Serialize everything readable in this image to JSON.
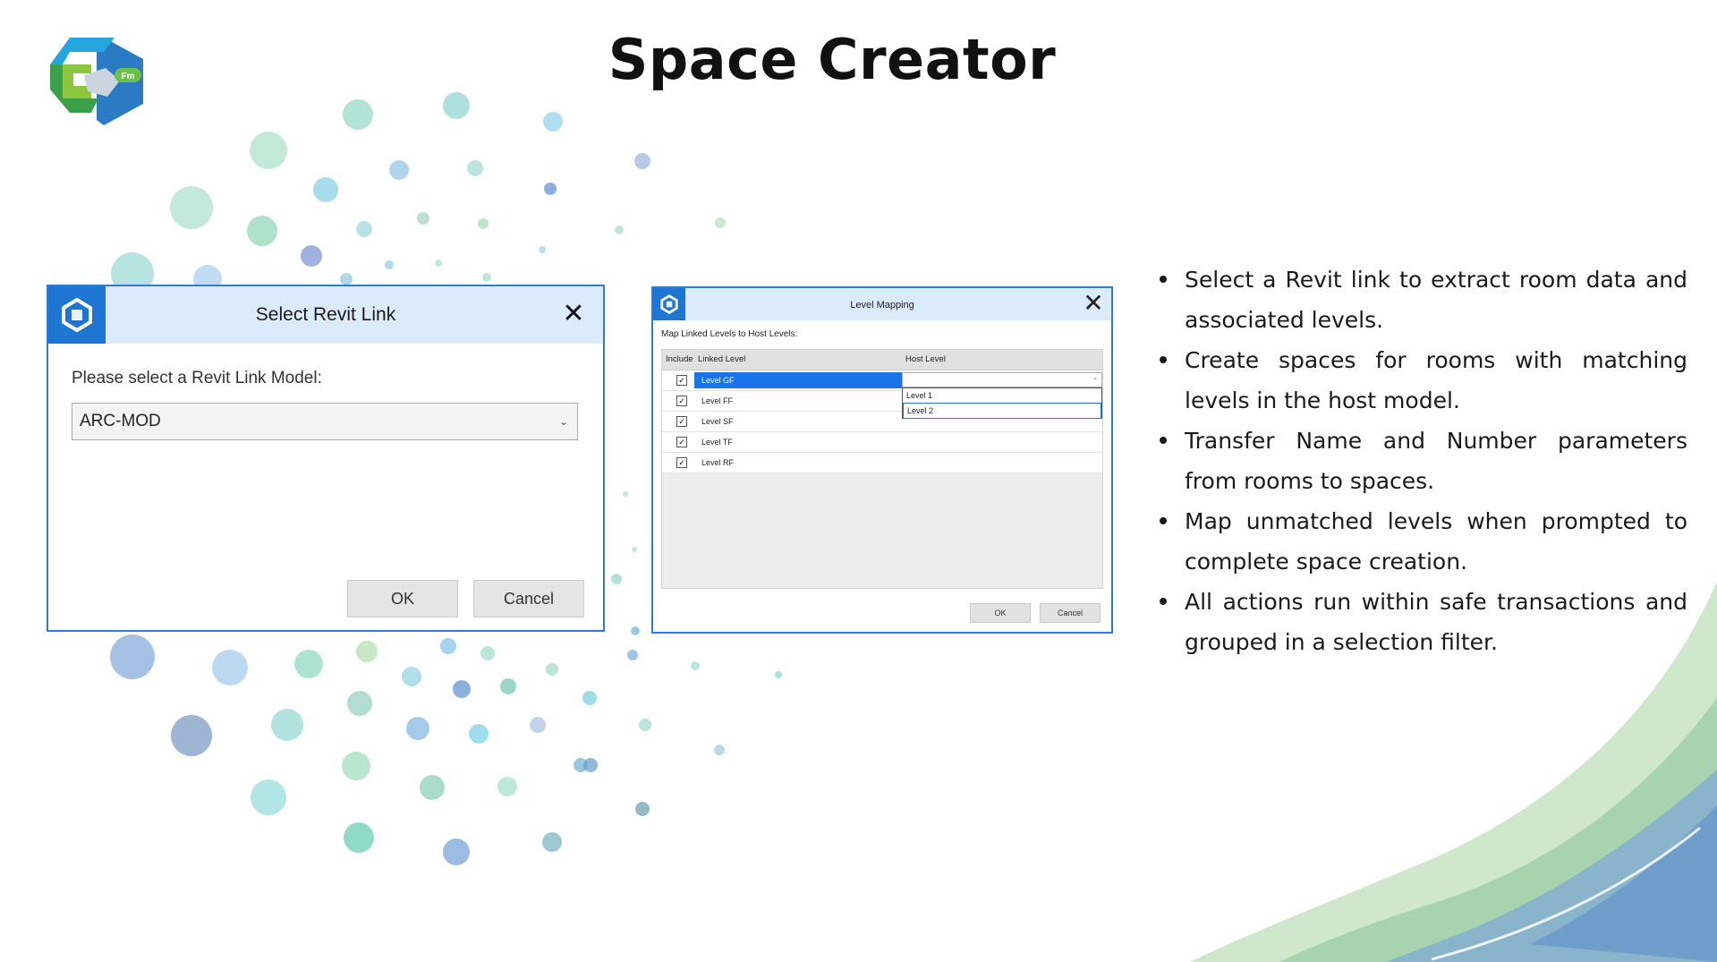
{
  "slide": {
    "title": "Space Creator",
    "logo_badge": "Fm"
  },
  "select_revit_link": {
    "title": "Select Revit Link",
    "prompt": "Please select a Revit Link Model:",
    "selected_model": "ARC-MOD",
    "ok_label": "OK",
    "cancel_label": "Cancel"
  },
  "level_mapping": {
    "title": "Level Mapping",
    "instruction": "Map Linked Levels to Host Levels:",
    "columns": {
      "include": "Include",
      "linked_level": "Linked Level",
      "host_level": "Host Level"
    },
    "rows": [
      {
        "linked_level": "Level GF",
        "checked": true,
        "selected": true
      },
      {
        "linked_level": "Level FF",
        "checked": true
      },
      {
        "linked_level": "Level SF",
        "checked": true
      },
      {
        "linked_level": "Level TF",
        "checked": true
      },
      {
        "linked_level": "Level RF",
        "checked": true
      }
    ],
    "host_level_options": [
      "Level 1",
      "Level 2"
    ],
    "ok_label": "OK",
    "cancel_label": "Cancel"
  },
  "features": [
    "Select a Revit link to extract room data and associated levels.",
    "Create spaces for rooms with matching levels in the host model.",
    "Transfer Name and Number parameters from rooms to spaces.",
    "Map unmatched levels when prompted to complete space creation.",
    "All actions run within safe transactions and grouped in a selection filter."
  ],
  "colors": {
    "dialog_border": "#2f7bd6",
    "dialog_titlebar": "#dcebfb",
    "app_icon_bg": "#1f76d2",
    "selection_blue": "#1a73e8"
  },
  "icons": {
    "logo": "cafm-logo-icon",
    "app": "revit-addin-icon",
    "close": "close-icon",
    "dropdown": "chevron-down-icon",
    "checkbox": "checkmark-icon"
  }
}
